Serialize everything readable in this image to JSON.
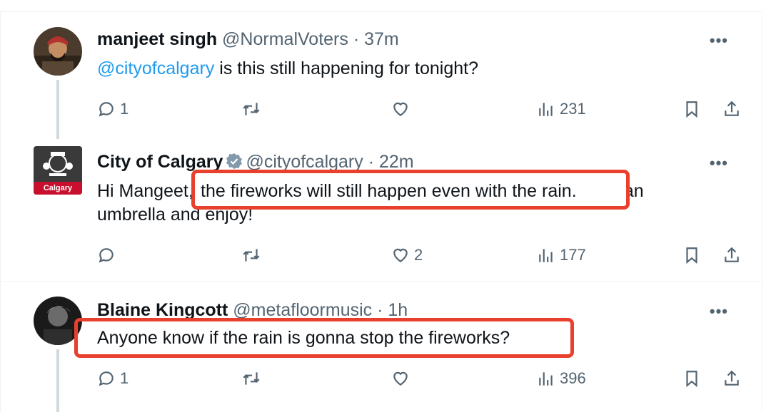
{
  "tweets": [
    {
      "name": "manjeet singh",
      "handle": "@NormalVoters",
      "sep": "·",
      "time": "37m",
      "mention": "@cityofcalgary",
      "text_after_mention": " is this still happening for tonight?",
      "replies": "1",
      "retweets": "",
      "likes": "",
      "views": "231"
    },
    {
      "name": "City of Calgary",
      "verified": true,
      "handle": "@cityofcalgary",
      "sep": "·",
      "time": "22m",
      "text_part1": "Hi Mangeet, ",
      "text_highlight": "the fireworks will still happen even with the rain.",
      "text_part2": " Grab an umbrella and enjoy!",
      "avatar_label": "Calgary",
      "replies": "",
      "retweets": "",
      "likes": "2",
      "views": "177"
    },
    {
      "name": "Blaine Kingcott",
      "handle": "@metafloormusic",
      "sep": "·",
      "time": "1h",
      "text": "Anyone know if the rain is gonna stop the fireworks?",
      "replies": "1",
      "retweets": "",
      "likes": "",
      "views": "396"
    }
  ],
  "more_label": "•••",
  "colors": {
    "accent": "#1d9bf0",
    "highlight": "#e8402c",
    "muted": "#536471",
    "calgary_red": "#c8102e"
  }
}
